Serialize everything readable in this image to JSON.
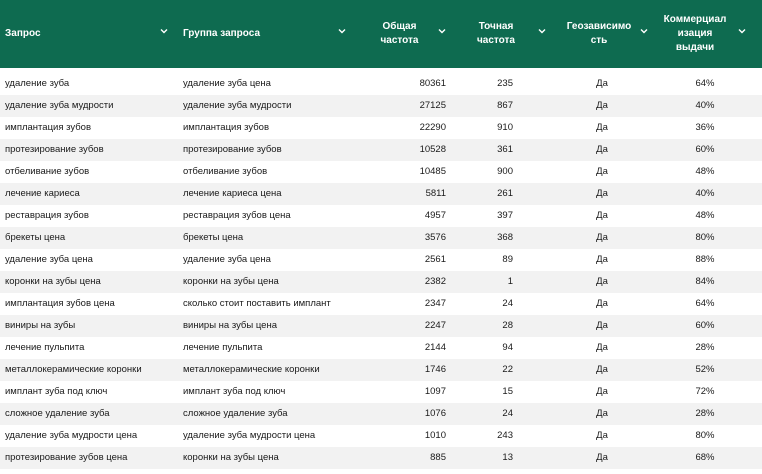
{
  "header": {
    "columns": [
      {
        "label": "Запрос"
      },
      {
        "label": "Группа запроса"
      },
      {
        "label": "Общая\nчастота"
      },
      {
        "label": "Точная\nчастота"
      },
      {
        "label": "Геозависимо\nсть"
      },
      {
        "label": "Коммерциал\nизация\nвыдачи"
      }
    ]
  },
  "rows": [
    {
      "query": "удаление зуба",
      "group": "удаление зуба цена",
      "total": "80361",
      "exact": "235",
      "geo": "Да",
      "commercial": "64%"
    },
    {
      "query": "удаление зуба мудрости",
      "group": "удаление зуба мудрости",
      "total": "27125",
      "exact": "867",
      "geo": "Да",
      "commercial": "40%"
    },
    {
      "query": "имплантация зубов",
      "group": "имплантация зубов",
      "total": "22290",
      "exact": "910",
      "geo": "Да",
      "commercial": "36%"
    },
    {
      "query": "протезирование зубов",
      "group": "протезирование зубов",
      "total": "10528",
      "exact": "361",
      "geo": "Да",
      "commercial": "60%"
    },
    {
      "query": "отбеливание зубов",
      "group": "отбеливание зубов",
      "total": "10485",
      "exact": "900",
      "geo": "Да",
      "commercial": "48%"
    },
    {
      "query": "лечение кариеса",
      "group": "лечение кариеса цена",
      "total": "5811",
      "exact": "261",
      "geo": "Да",
      "commercial": "40%"
    },
    {
      "query": "реставрация зубов",
      "group": "реставрация зубов цена",
      "total": "4957",
      "exact": "397",
      "geo": "Да",
      "commercial": "48%"
    },
    {
      "query": "брекеты цена",
      "group": "брекеты цена",
      "total": "3576",
      "exact": "368",
      "geo": "Да",
      "commercial": "80%"
    },
    {
      "query": "удаление зуба цена",
      "group": "удаление зуба цена",
      "total": "2561",
      "exact": "89",
      "geo": "Да",
      "commercial": "88%"
    },
    {
      "query": "коронки на зубы цена",
      "group": "коронки на зубы цена",
      "total": "2382",
      "exact": "1",
      "geo": "Да",
      "commercial": "84%"
    },
    {
      "query": "имплантация зубов цена",
      "group": "сколько стоит поставить имплант",
      "total": "2347",
      "exact": "24",
      "geo": "Да",
      "commercial": "64%"
    },
    {
      "query": "виниры на зубы",
      "group": "виниры на зубы цена",
      "total": "2247",
      "exact": "28",
      "geo": "Да",
      "commercial": "60%"
    },
    {
      "query": "лечение пульпита",
      "group": "лечение пульпита",
      "total": "2144",
      "exact": "94",
      "geo": "Да",
      "commercial": "28%"
    },
    {
      "query": "металлокерамические коронки",
      "group": "металлокерамические коронки",
      "total": "1746",
      "exact": "22",
      "geo": "Да",
      "commercial": "52%"
    },
    {
      "query": "имплант зуба под ключ",
      "group": "имплант зуба под ключ",
      "total": "1097",
      "exact": "15",
      "geo": "Да",
      "commercial": "72%"
    },
    {
      "query": "сложное удаление зуба",
      "group": "сложное удаление зуба",
      "total": "1076",
      "exact": "24",
      "geo": "Да",
      "commercial": "28%"
    },
    {
      "query": "удаление зуба мудрости цена",
      "group": "удаление зуба мудрости цена",
      "total": "1010",
      "exact": "243",
      "geo": "Да",
      "commercial": "80%"
    },
    {
      "query": "протезирование зубов цена",
      "group": "коронки на зубы цена",
      "total": "885",
      "exact": "13",
      "geo": "Да",
      "commercial": "68%"
    }
  ],
  "colors": {
    "header_bg": "#0e6b50",
    "header_text": "#ffffff",
    "stripe": "#f2f2f2"
  },
  "icons": {
    "filter": "chevron-down-icon"
  }
}
